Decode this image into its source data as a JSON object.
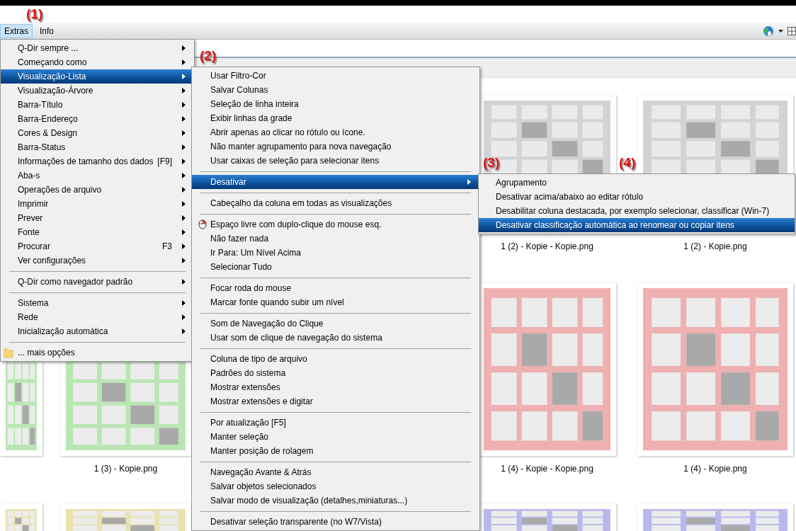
{
  "annotations": [
    {
      "label": "(1)"
    },
    {
      "label": "(2)"
    },
    {
      "label": "(3)"
    },
    {
      "label": "(4)"
    }
  ],
  "menu_bar": {
    "items": [
      {
        "label": "Extras",
        "selected": true
      },
      {
        "label": "Info",
        "selected": false
      }
    ]
  },
  "file_labels": [
    {
      "label": "1 (2) - Kopie - Kopie.png"
    },
    {
      "label": "1 (2) - Kopie.png"
    },
    {
      "label": "1 (3) - Kopie.png"
    },
    {
      "label": "1 (4) - Kopie - Kopie.png"
    },
    {
      "label": "1 (4) - Kopie.png"
    }
  ],
  "menus": [
    {
      "items": [
        {
          "kind": "item",
          "label": "Q-Dir sempre ...",
          "submenu": true,
          "selected": false
        },
        {
          "kind": "item",
          "label": "Começando como",
          "submenu": true,
          "selected": false
        },
        {
          "kind": "item",
          "label": "Visualização-Lista",
          "submenu": true,
          "selected": true
        },
        {
          "kind": "item",
          "label": "Visualização-Árvore",
          "submenu": true,
          "selected": false
        },
        {
          "kind": "item",
          "label": "Barra-Título",
          "submenu": true,
          "selected": false
        },
        {
          "kind": "item",
          "label": "Barra-Endereço",
          "submenu": true,
          "selected": false
        },
        {
          "kind": "item",
          "label": "Cores & Design",
          "submenu": true,
          "selected": false
        },
        {
          "kind": "item",
          "label": "Barra-Status",
          "submenu": true,
          "selected": false
        },
        {
          "kind": "item",
          "label": "Informações de tamanho dos dados",
          "shortcut": "[F9]",
          "submenu": true,
          "selected": false
        },
        {
          "kind": "item",
          "label": "Aba-s",
          "submenu": true,
          "selected": false
        },
        {
          "kind": "item",
          "label": "Operações de arquivo",
          "submenu": true,
          "selected": false
        },
        {
          "kind": "item",
          "label": "Imprimir",
          "submenu": true,
          "selected": false
        },
        {
          "kind": "item",
          "label": "Prever",
          "submenu": true,
          "selected": false
        },
        {
          "kind": "item",
          "label": "Fonte",
          "submenu": true,
          "selected": false
        },
        {
          "kind": "item",
          "label": "Procurar",
          "shortcut": "F3",
          "submenu": true,
          "selected": false
        },
        {
          "kind": "item",
          "label": "Ver configurações",
          "submenu": true,
          "selected": false
        },
        {
          "kind": "separator"
        },
        {
          "kind": "item",
          "label": "Q-Dir como navegador padrão",
          "submenu": true,
          "selected": false
        },
        {
          "kind": "separator"
        },
        {
          "kind": "item",
          "label": "Sistema",
          "submenu": true,
          "selected": false
        },
        {
          "kind": "item",
          "label": "Rede",
          "submenu": true,
          "selected": false
        },
        {
          "kind": "item",
          "label": "Inicialização automática",
          "submenu": true,
          "selected": false
        },
        {
          "kind": "separator"
        },
        {
          "kind": "folder_item",
          "label": "... mais opções",
          "submenu": false,
          "selected": false
        }
      ]
    },
    {
      "items": [
        {
          "kind": "item",
          "label": "Usar Filtro-Cor",
          "submenu": false,
          "selected": false
        },
        {
          "kind": "item",
          "label": "Salvar Colunas",
          "submenu": false,
          "selected": false
        },
        {
          "kind": "item",
          "label": "Seleção de linha inteira",
          "submenu": false,
          "selected": false
        },
        {
          "kind": "item",
          "label": "Exibir linhas da grade",
          "submenu": false,
          "selected": false
        },
        {
          "kind": "item",
          "label": "Abrir apenas ao clicar no rótulo ou ícone.",
          "submenu": false,
          "selected": false
        },
        {
          "kind": "item",
          "label": "Não manter agrupamento para nova navegação",
          "submenu": false,
          "selected": false
        },
        {
          "kind": "item",
          "label": "Usar caixas de seleção para selecionar itens",
          "submenu": false,
          "selected": false
        },
        {
          "kind": "separator"
        },
        {
          "kind": "item",
          "label": "Desativar",
          "submenu": true,
          "selected": true
        },
        {
          "kind": "separator"
        },
        {
          "kind": "item",
          "label": "Cabeçalho da coluna em todas as visualizações",
          "submenu": false,
          "selected": false
        },
        {
          "kind": "separator"
        },
        {
          "kind": "mouse_item",
          "label": "Espaço livre com duplo-clique do mouse esq.",
          "submenu": false,
          "selected": false
        },
        {
          "kind": "item",
          "label": "Não fazer nada",
          "submenu": false,
          "selected": false
        },
        {
          "kind": "item",
          "label": "Ir Para: Um Nível Acima",
          "submenu": false,
          "selected": false
        },
        {
          "kind": "item",
          "label": "Selecionar Tudo",
          "submenu": false,
          "selected": false
        },
        {
          "kind": "separator"
        },
        {
          "kind": "item",
          "label": "Focar roda do mouse",
          "submenu": false,
          "selected": false
        },
        {
          "kind": "item",
          "label": "Marcar fonte quando subir um nível",
          "submenu": false,
          "selected": false
        },
        {
          "kind": "separator"
        },
        {
          "kind": "item",
          "label": "Som de Navegação do Clique",
          "submenu": false,
          "selected": false
        },
        {
          "kind": "item",
          "label": "Usar som de clique de navegação do sistema",
          "submenu": false,
          "selected": false
        },
        {
          "kind": "separator"
        },
        {
          "kind": "item",
          "label": "Coluna de tipo de arquivo",
          "submenu": false,
          "selected": false
        },
        {
          "kind": "item",
          "label": "Padrões do sistema",
          "submenu": false,
          "selected": false
        },
        {
          "kind": "item",
          "label": "Mostrar extensões",
          "submenu": false,
          "selected": false
        },
        {
          "kind": "item",
          "label": "Mostrar extensões e digitar",
          "submenu": false,
          "selected": false
        },
        {
          "kind": "separator"
        },
        {
          "kind": "item",
          "label": "Por atualização [F5]",
          "submenu": false,
          "selected": false
        },
        {
          "kind": "item",
          "label": "Manter seleção",
          "submenu": false,
          "selected": false
        },
        {
          "kind": "item",
          "label": "Manter posição de rolagem",
          "submenu": false,
          "selected": false
        },
        {
          "kind": "separator"
        },
        {
          "kind": "item",
          "label": "Navegação Avante & Atrás",
          "submenu": false,
          "selected": false
        },
        {
          "kind": "item",
          "label": "Salvar objetos selecionados",
          "submenu": false,
          "selected": false
        },
        {
          "kind": "item",
          "label": "Salvar modo de visualização (detalhes,miniaturas...)",
          "submenu": false,
          "selected": false
        },
        {
          "kind": "separator"
        },
        {
          "kind": "item",
          "label": "Desativar seleção transparente (no W7/Vista)",
          "submenu": false,
          "selected": false
        }
      ]
    },
    {
      "items": [
        {
          "kind": "item",
          "label": "Agrupamento",
          "submenu": false,
          "selected": false
        },
        {
          "kind": "item",
          "label": "Desativar acima/abaixo ao editar rótulo",
          "submenu": false,
          "selected": false
        },
        {
          "kind": "item",
          "label": "Desabilitar coluna destacada, por exemplo selecionar, classificar (Win-7)",
          "submenu": false,
          "selected": false
        },
        {
          "kind": "item",
          "label": "Desativar classificação automática ao renomear ou copiar itens",
          "submenu": false,
          "selected": true
        }
      ]
    }
  ]
}
